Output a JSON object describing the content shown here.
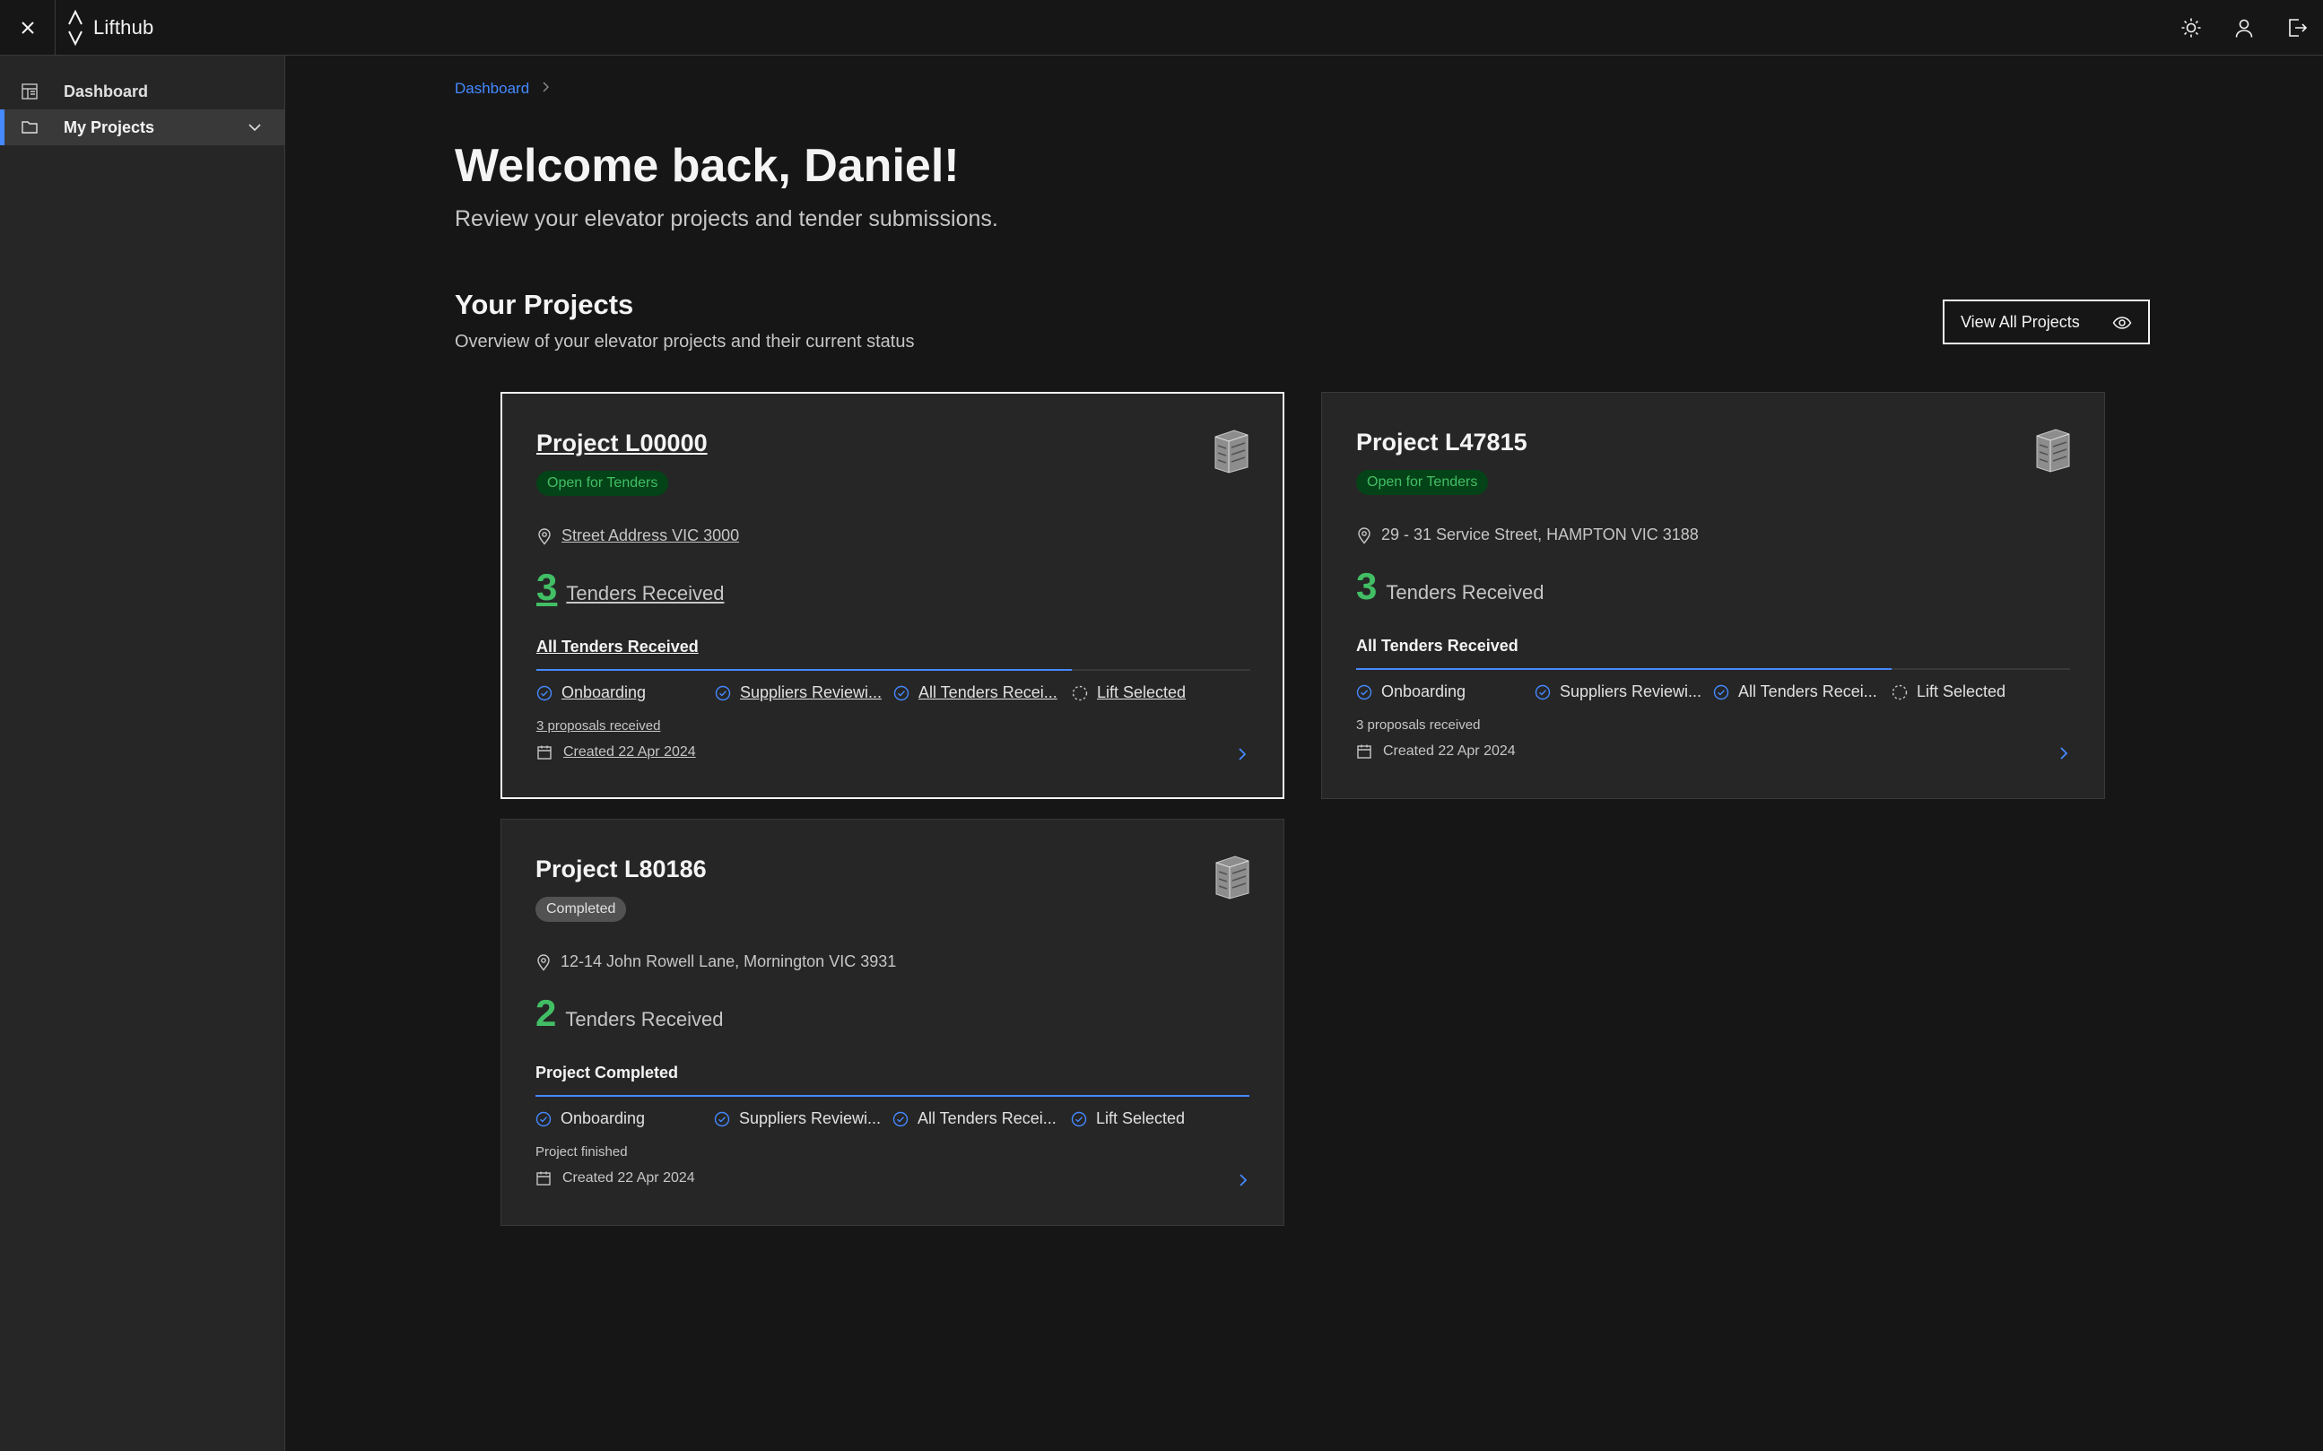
{
  "app": {
    "name": "Lifthub"
  },
  "sidebar": {
    "items": [
      {
        "label": "Dashboard",
        "icon": "dashboard-icon"
      },
      {
        "label": "My Projects",
        "icon": "folder-icon"
      }
    ]
  },
  "breadcrumb": {
    "items": [
      "Dashboard"
    ]
  },
  "welcome": {
    "title": "Welcome back, Daniel!",
    "subtitle": "Review your elevator projects and tender submissions."
  },
  "section": {
    "title": "Your Projects",
    "subtitle": "Overview of your elevator projects and their current status",
    "view_all": "View All Projects"
  },
  "colors": {
    "accent": "#4589ff",
    "success": "#42be65",
    "background": "#161616",
    "card": "#262626"
  },
  "projects": [
    {
      "title": "Project L00000",
      "status": "Open for Tenders",
      "address": "Street Address VIC 3000",
      "tenders_count": "3",
      "tenders_label": "Tenders Received",
      "stage": "All Tenders Received",
      "progress": 0.75,
      "steps": [
        "Onboarding",
        "Suppliers Reviewi...",
        "All Tenders Recei...",
        "Lift Selected"
      ],
      "note": "3 proposals received",
      "created": "Created 22 Apr 2024"
    },
    {
      "title": "Project L47815",
      "status": "Open for Tenders",
      "address": "29 - 31 Service Street, HAMPTON VIC 3188",
      "tenders_count": "3",
      "tenders_label": "Tenders Received",
      "stage": "All Tenders Received",
      "progress": 0.75,
      "steps": [
        "Onboarding",
        "Suppliers Reviewi...",
        "All Tenders Recei...",
        "Lift Selected"
      ],
      "note": "3 proposals received",
      "created": "Created 22 Apr 2024"
    },
    {
      "title": "Project L80186",
      "status": "Completed",
      "address": "12-14 John Rowell Lane, Mornington VIC 3931",
      "tenders_count": "2",
      "tenders_label": "Tenders Received",
      "stage": "Project Completed",
      "progress": 1.0,
      "steps": [
        "Onboarding",
        "Suppliers Reviewi...",
        "All Tenders Recei...",
        "Lift Selected"
      ],
      "note": "Project finished",
      "created": "Created 22 Apr 2024"
    }
  ]
}
